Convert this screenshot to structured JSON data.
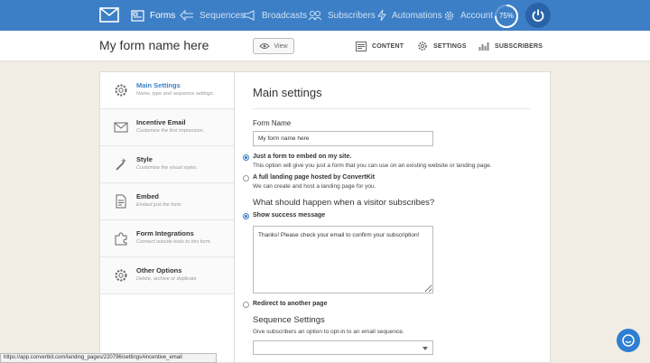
{
  "nav": {
    "items": [
      {
        "label": "Forms",
        "icon": "forms-icon",
        "active": true
      },
      {
        "label": "Sequences",
        "icon": "sequences-icon"
      },
      {
        "label": "Broadcasts",
        "icon": "broadcasts-icon"
      },
      {
        "label": "Subscribers",
        "icon": "subscribers-icon"
      },
      {
        "label": "Automations",
        "icon": "automations-icon"
      },
      {
        "label": "Account",
        "icon": "account-icon"
      }
    ],
    "progress": "75%",
    "progress_value": 75,
    "colors": {
      "bar": "#3d7fc6",
      "inactive_text": "#cfe0f2"
    }
  },
  "header": {
    "form_title": "My form name here",
    "view_label": "View",
    "tabs": [
      {
        "label": "CONTENT",
        "icon": "content-icon"
      },
      {
        "label": "SETTINGS",
        "icon": "gear-icon",
        "active": true
      },
      {
        "label": "SUBSCRIBERS",
        "icon": "bar-chart-icon"
      }
    ]
  },
  "sidebar": {
    "items": [
      {
        "title": "Main Settings",
        "subtitle": "Name, type and sequence settings.",
        "icon": "gear-icon",
        "active": true
      },
      {
        "title": "Incentive Email",
        "subtitle": "Customize the first impression.",
        "icon": "envelope-icon"
      },
      {
        "title": "Style",
        "subtitle": "Customize the visual styles.",
        "icon": "magic-wand-icon"
      },
      {
        "title": "Embed",
        "subtitle": "Embed just the form.",
        "icon": "document-icon"
      },
      {
        "title": "Form Integrations",
        "subtitle": "Connect outside tools to this form.",
        "icon": "puzzle-icon"
      },
      {
        "title": "Other Options",
        "subtitle": "Delete, archive or duplicate",
        "icon": "cog-icon"
      }
    ]
  },
  "main": {
    "title": "Main settings",
    "form_name_label": "Form Name",
    "form_name_value": "My form name here",
    "embed_option": {
      "label": "Just a form to embed on my site.",
      "desc": "This option will give you just a form that you can use on an existing website or landing page.",
      "checked": true
    },
    "landing_option": {
      "label": "A full landing page hosted by ConvertKit",
      "desc": "We can create and host a landing page for you.",
      "checked": false
    },
    "subscribe_heading": "What should happen when a visitor subscribes?",
    "success_option": {
      "label": "Show success message",
      "checked": true
    },
    "success_message": "Thanks! Please check your email to confirm your subscription!",
    "redirect_option": {
      "label": "Redirect to another page",
      "checked": false
    },
    "sequence_heading": "Sequence Settings",
    "sequence_desc": "Give subscribers an option to opt-in to an email sequence.",
    "sequence_select_value": ""
  },
  "status_url": "https://app.convertkit.com/landing_pages/220796/settings#incentive_email"
}
